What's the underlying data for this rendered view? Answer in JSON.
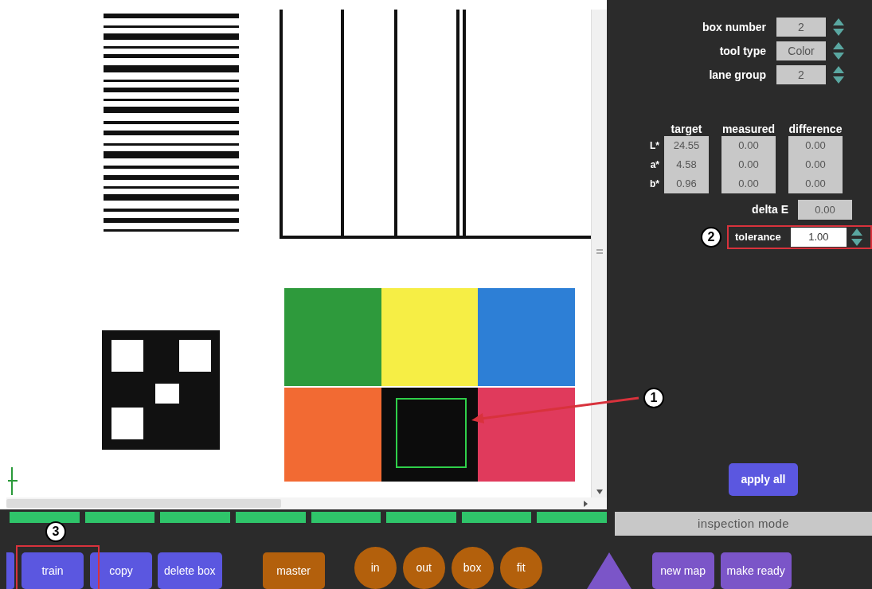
{
  "settings": [
    {
      "label": "box number",
      "value": "2"
    },
    {
      "label": "tool type",
      "value": "Color"
    },
    {
      "label": "lane group",
      "value": "2"
    }
  ],
  "color_table": {
    "columns": [
      "target",
      "measured",
      "difference"
    ],
    "rows": [
      {
        "label": "L*",
        "values": [
          "24.55",
          "0.00",
          "0.00"
        ]
      },
      {
        "label": "a*",
        "values": [
          "4.58",
          "0.00",
          "0.00"
        ]
      },
      {
        "label": "b*",
        "values": [
          "0.96",
          "0.00",
          "0.00"
        ]
      }
    ],
    "delta_e": {
      "label": "delta E",
      "value": "0.00"
    },
    "tolerance": {
      "label": "tolerance",
      "value": "1.00"
    }
  },
  "apply_button": "apply all",
  "mode_label": "inspection mode",
  "buttons": [
    {
      "kind": "stub",
      "color": "#5b57e0"
    },
    {
      "kind": "rect",
      "label": "train",
      "color": "#5b57e0"
    },
    {
      "kind": "rect",
      "label": "copy",
      "color": "#5b57e0"
    },
    {
      "kind": "rect",
      "label": "delete box",
      "color": "#5b57e0"
    },
    {
      "kind": "rect",
      "label": "master",
      "color": "#b3600c"
    },
    {
      "kind": "round",
      "label": "in",
      "color": "#b3600c"
    },
    {
      "kind": "round",
      "label": "out",
      "color": "#b3600c"
    },
    {
      "kind": "round",
      "label": "box",
      "color": "#b3600c"
    },
    {
      "kind": "round",
      "label": "fit",
      "color": "#b3600c"
    },
    {
      "kind": "triangle",
      "color": "#7b55c8"
    },
    {
      "kind": "rect",
      "label": "new map",
      "color": "#7b55c8"
    },
    {
      "kind": "rect",
      "label": "make ready",
      "color": "#7b55c8"
    }
  ],
  "callouts": [
    "1",
    "2",
    "3"
  ]
}
